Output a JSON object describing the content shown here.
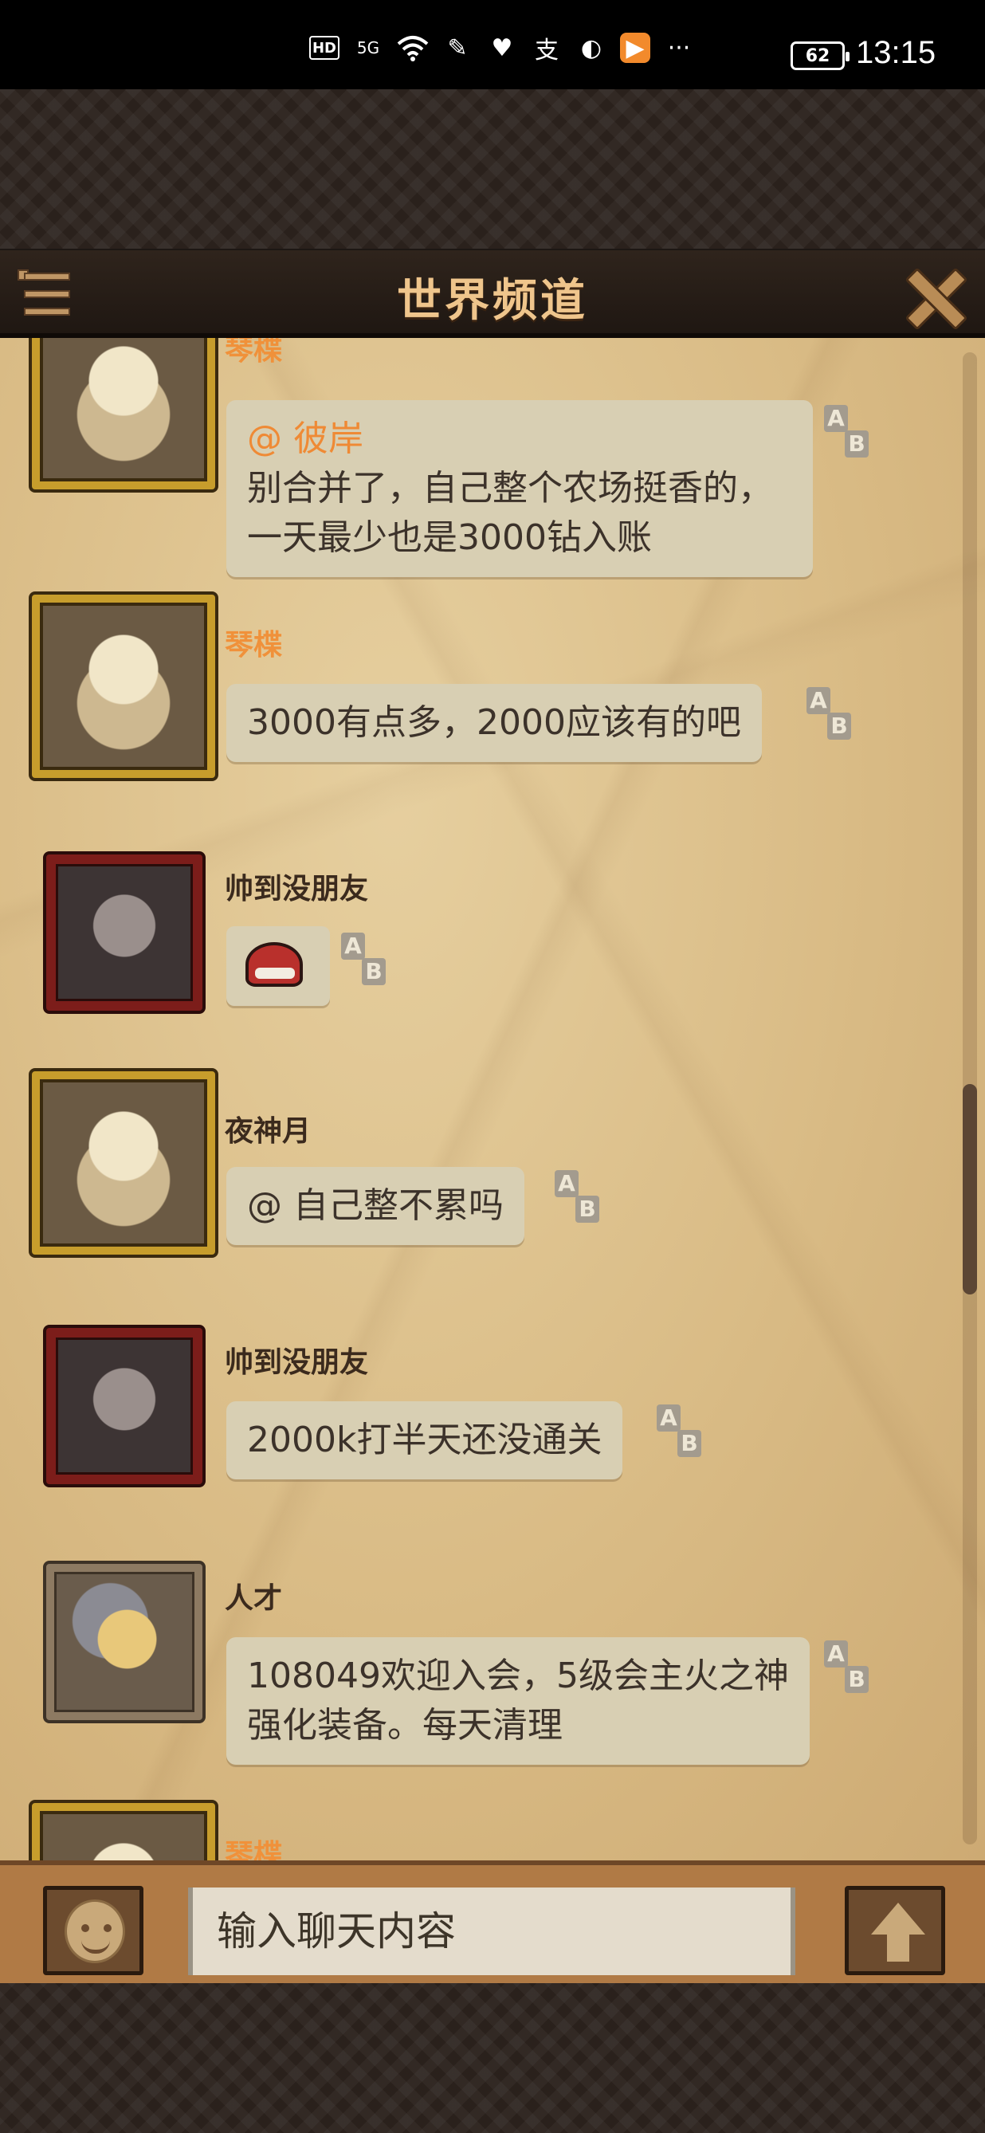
{
  "status_bar": {
    "time": "13:15",
    "battery": "62",
    "hd_label": "HD",
    "network_label": "5G",
    "more_label": "···"
  },
  "header": {
    "title": "世界频道"
  },
  "messages": [
    {
      "name": "琴楪",
      "mention": "@ 彼岸",
      "text": "别合并了，自己整个农场挺香的，一天最少也是3000钻入账"
    },
    {
      "name": "琴楪",
      "text": "3000有点多，2000应该有的吧"
    },
    {
      "name": "帅到没朋友",
      "sticker": "red-hat-sticker"
    },
    {
      "name": "夜神月",
      "text": "@ 自己整不累吗"
    },
    {
      "name": "帅到没朋友",
      "text": "2000k打半天还没通关"
    },
    {
      "name": "人才",
      "text": "108049欢迎入会，5级会主火之神强化装备。每天清理"
    },
    {
      "name": "琴楪"
    }
  ],
  "translate_icon": {
    "a": "A",
    "b": "B"
  },
  "input": {
    "placeholder": "输入聊天内容"
  },
  "colors": {
    "title": "#efc58c",
    "name_highlight": "#f0913a",
    "bubble_bg": "#d8cfb3",
    "parchment": "#d9bb85"
  }
}
